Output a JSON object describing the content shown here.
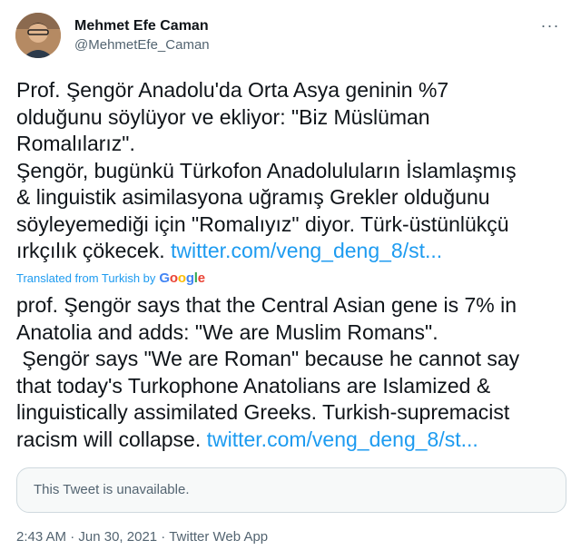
{
  "author": {
    "display_name": "Mehmet Efe Caman",
    "handle": "@MehmetEfe_Caman",
    "avatar_icon": "user-avatar-photo"
  },
  "more_icon": "more-horizontal-icon",
  "tweet": {
    "original_text": "Prof. Şengör Anadolu'da Orta Asya geninin %7\nolduğunu söylüyor ve ekliyor: \"Biz Müslüman\nRomalılarız\".\nŞengör, bugünkü Türkofon Anadoluluların İslamlaşmış\n& linguistik asimilasyona uğramış Grekler olduğunu\nsöyleyemediği için \"Romalıyız\" diyor. Türk-üstünlükçü\nırkçılık çökecek. ",
    "original_link": "twitter.com/veng_deng_8/st...",
    "translated_by_label": "Translated from Turkish by",
    "translator": "Google",
    "translated_text": "prof. Şengör says that the Central Asian gene is 7% in\nAnatolia and adds: \"We are Muslim Romans\".\n Şengör says \"We are Roman\" because he cannot say\nthat today's Turkophone Anatolians are Islamized &\nlinguistically assimilated Greeks. Turkish-supremacist\nracism will collapse. ",
    "translated_link": "twitter.com/veng_deng_8/st...",
    "quoted_unavailable": "This Tweet is unavailable."
  },
  "meta": {
    "time": "2:43 AM",
    "separator": " · ",
    "date": "Jun 30, 2021",
    "source": "Twitter Web App"
  },
  "colors": {
    "link": "#1d9bf0",
    "secondary_text": "#536471",
    "primary_text": "#0f1419"
  }
}
